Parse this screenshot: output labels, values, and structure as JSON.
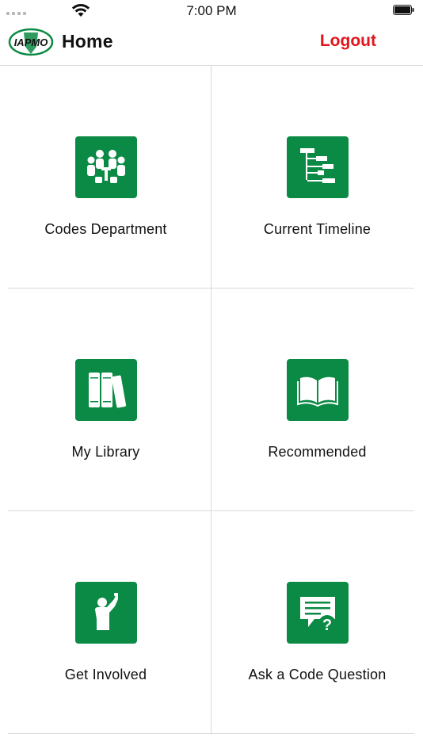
{
  "status_bar": {
    "time": "7:00 PM"
  },
  "nav": {
    "title": "Home",
    "logout_label": "Logout",
    "logo_text": "IAPMO"
  },
  "menu": [
    {
      "label": "Codes Department",
      "icon": "meeting-icon"
    },
    {
      "label": "Current Timeline",
      "icon": "timeline-icon"
    },
    {
      "label": "My Library",
      "icon": "books-icon"
    },
    {
      "label": "Recommended",
      "icon": "open-book-icon"
    },
    {
      "label": "Get Involved",
      "icon": "raise-hand-icon"
    },
    {
      "label": "Ask a Code Question",
      "icon": "question-bubble-icon"
    }
  ],
  "colors": {
    "tile": "#0a8a44",
    "logout": "#e3141b",
    "divider": "#d9d9d9"
  }
}
